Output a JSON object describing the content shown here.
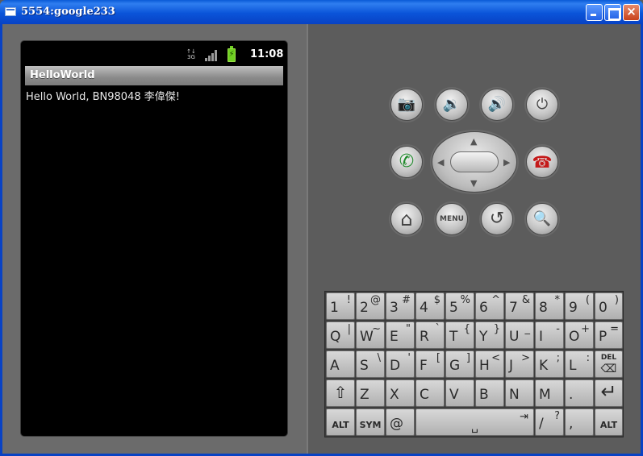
{
  "window": {
    "title": "5554:google233",
    "close_glyph": "×"
  },
  "status_bar": {
    "network": "3G",
    "battery_icon": "⚡",
    "time": "11:08"
  },
  "app": {
    "title": "HelloWorld",
    "message": "Hello World, BN98048 李偉傑!"
  },
  "controls": {
    "camera_glyph": "📷",
    "volume_down_glyph": "🔉",
    "volume_up_glyph": "🔊",
    "power_glyph": "⏻",
    "call_glyph": "✆",
    "end_call_glyph": "☎",
    "home_glyph": "⌂",
    "menu_label": "MENU",
    "back_glyph": "↺",
    "search_glyph": "🔍",
    "dpad": {
      "up": "▲",
      "down": "▼",
      "left": "◀",
      "right": "▶"
    }
  },
  "keyboard": {
    "row1": [
      {
        "main": "1",
        "alt": "!"
      },
      {
        "main": "2",
        "alt": "@"
      },
      {
        "main": "3",
        "alt": "#"
      },
      {
        "main": "4",
        "alt": "$"
      },
      {
        "main": "5",
        "alt": "%"
      },
      {
        "main": "6",
        "alt": "^"
      },
      {
        "main": "7",
        "alt": "&"
      },
      {
        "main": "8",
        "alt": "*"
      },
      {
        "main": "9",
        "alt": "("
      },
      {
        "main": "0",
        "alt": ")"
      }
    ],
    "row2": [
      {
        "main": "Q",
        "alt": "|"
      },
      {
        "main": "W",
        "alt": "~"
      },
      {
        "main": "E",
        "alt": "\""
      },
      {
        "main": "R",
        "alt": "`"
      },
      {
        "main": "T",
        "alt": "{"
      },
      {
        "main": "Y",
        "alt": "}"
      },
      {
        "main": "U",
        "alt": "_"
      },
      {
        "main": "I",
        "alt": "-"
      },
      {
        "main": "O",
        "alt": "+"
      },
      {
        "main": "P",
        "alt": "="
      }
    ],
    "row3": [
      {
        "main": "A",
        "alt": ""
      },
      {
        "main": "S",
        "alt": "\\"
      },
      {
        "main": "D",
        "alt": "'"
      },
      {
        "main": "F",
        "alt": "["
      },
      {
        "main": "G",
        "alt": "]"
      },
      {
        "main": "H",
        "alt": "<"
      },
      {
        "main": "J",
        "alt": ">"
      },
      {
        "main": "K",
        "alt": ";"
      },
      {
        "main": "L",
        "alt": ":"
      }
    ],
    "del_label": "DEL",
    "del_glyph": "⌫",
    "shift_glyph": "⇧",
    "row4": [
      {
        "main": "Z",
        "alt": ""
      },
      {
        "main": "X",
        "alt": ""
      },
      {
        "main": "C",
        "alt": ""
      },
      {
        "main": "V",
        "alt": ""
      },
      {
        "main": "B",
        "alt": ""
      },
      {
        "main": "N",
        "alt": ""
      },
      {
        "main": "M",
        "alt": ""
      },
      {
        "main": ".",
        "alt": ""
      }
    ],
    "enter_glyph": "↵",
    "alt_label": "ALT",
    "sym_label": "SYM",
    "at_label": "@",
    "space_glyph": "␣",
    "tab_glyph": "⇥",
    "slash_label": "/",
    "question_label": "?",
    "comma_label": ","
  }
}
